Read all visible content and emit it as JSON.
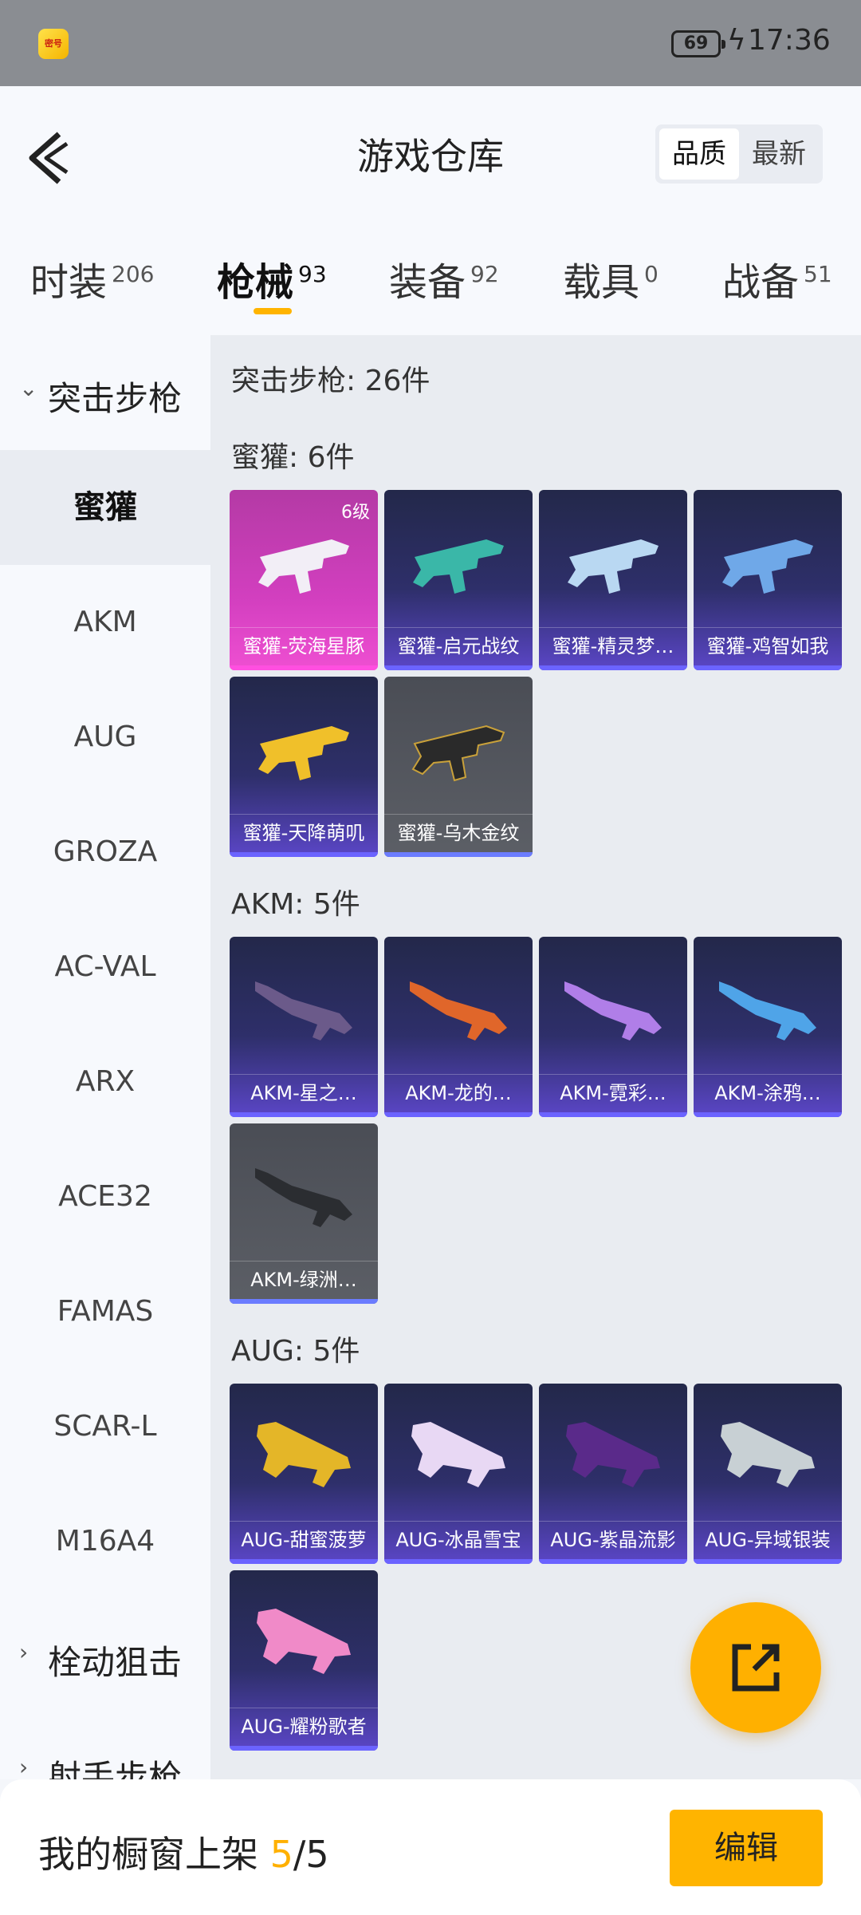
{
  "status_bar": {
    "app_icon_text": "密号",
    "battery": "69",
    "time": "17:36"
  },
  "header": {
    "title": "游戏仓库",
    "sort": [
      "品质",
      "最新"
    ]
  },
  "tabs": [
    {
      "label": "时装",
      "count": "206"
    },
    {
      "label": "枪械",
      "count": "93"
    },
    {
      "label": "装备",
      "count": "92"
    },
    {
      "label": "载具",
      "count": "0"
    },
    {
      "label": "战备",
      "count": "51"
    }
  ],
  "sidebar": {
    "group1": "突击步枪",
    "items": [
      "蜜獾",
      "AKM",
      "AUG",
      "GROZA",
      "AC-VAL",
      "ARX",
      "ACE32",
      "FAMAS",
      "SCAR-L",
      "M16A4"
    ],
    "group2": "栓动狙击",
    "group3": "射手步枪"
  },
  "content": {
    "main_title": "突击步枪: 26件",
    "sections": [
      {
        "title": "蜜獾: 6件",
        "cards": [
          "蜜獾-荧海星豚",
          "蜜獾-启元战纹",
          "蜜獾-精灵梦…",
          "蜜獾-鸡智如我",
          "蜜獾-天降萌叽",
          "蜜獾-乌木金纹"
        ]
      },
      {
        "title": "AKM: 5件",
        "cards": [
          "AKM-星之…",
          "AKM-龙的…",
          "AKM-霓彩…",
          "AKM-涂鸦…",
          "AKM-绿洲…"
        ]
      },
      {
        "title": "AUG: 5件",
        "cards": [
          "AUG-甜蜜菠萝",
          "AUG-冰晶雪宝",
          "AUG-紫晶流影",
          "AUG-异域银装",
          "AUG-耀粉歌者"
        ]
      }
    ],
    "grade_badge": "6级"
  },
  "bottom": {
    "prefix": "我的橱窗上架 ",
    "count": "5",
    "total": "/5",
    "edit": "编辑"
  },
  "colors": {
    "accent": "#ffb400",
    "card_purple": "#5b46c7",
    "card_pink": "#ef4fd2"
  }
}
